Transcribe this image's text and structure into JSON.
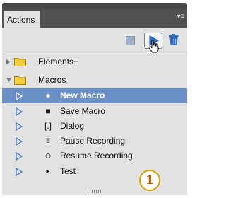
{
  "panel": {
    "tab_label": "Actions",
    "menu_icon": "panel-menu-icon"
  },
  "toolbar": {
    "stop_icon": "stop-icon",
    "play_icon": "play-icon",
    "trash_icon": "trash-icon"
  },
  "sets": [
    {
      "label": "Elements+",
      "expanded": false
    },
    {
      "label": "Macros",
      "expanded": true
    }
  ],
  "actions": [
    {
      "label": "New Macro",
      "icon": "●",
      "selected": true
    },
    {
      "label": "Save Macro",
      "icon": "■",
      "selected": false
    },
    {
      "label": "Dialog",
      "icon": "[.]",
      "selected": false
    },
    {
      "label": "Pause Recording",
      "icon": "II",
      "selected": false
    },
    {
      "label": "Resume Recording",
      "icon": "○",
      "selected": false
    },
    {
      "label": "Test",
      "icon": "▸",
      "selected": false
    }
  ],
  "badge": {
    "text": "1"
  },
  "colors": {
    "selection": "#6b8fc7",
    "play_blue": "#2a6fc9",
    "folder_yellow": "#f1cf3a",
    "badge_orange": "#c25a00"
  }
}
